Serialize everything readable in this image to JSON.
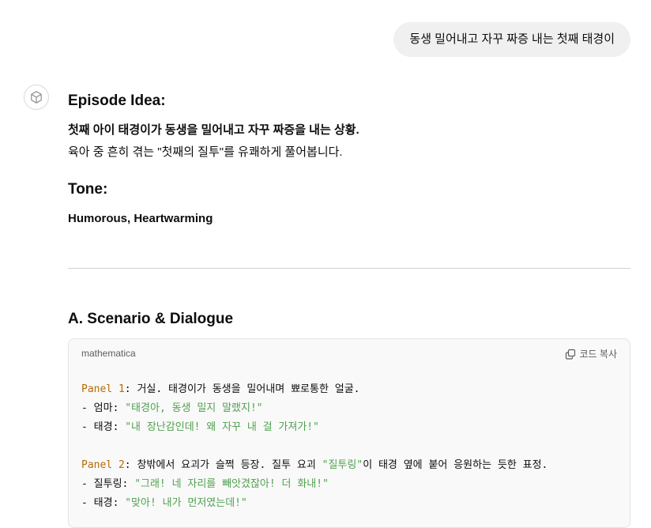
{
  "user_message": "동생 밀어내고 자꾸 짜증 내는 첫째 태경이",
  "assistant": {
    "avatar_icon": "openai-logo-icon",
    "episode_heading": "Episode Idea:",
    "episode_bold": "첫째 아이 태경이가 동생을 밀어내고 자꾸 짜증을 내는 상황.",
    "episode_text": "육아 중 흔히 겪는 \"첫째의 질투\"를 유쾌하게 풀어봅니다.",
    "tone_heading": "Tone:",
    "tone_text": "Humorous, Heartwarming",
    "scenario_heading": "A. Scenario & Dialogue"
  },
  "code_block": {
    "language": "mathematica",
    "copy_label": "코드 복사",
    "copy_icon": "copy-icon",
    "panel1": {
      "label": "Panel 1",
      "desc": ": 거실. 태경이가 동생을 밀어내며 뾰로통한 얼굴.",
      "line1_prefix": "- 엄마: ",
      "line1_quote": "\"태경아, 동생 밀지 말랬지!\"",
      "line2_prefix": "- 태경: ",
      "line2_quote": "\"내 장난감인데! 왜 자꾸 내 걸 가져가!\""
    },
    "panel2": {
      "label": "Panel 2",
      "desc_a": ": 창밖에서 요괴가 슬쩍 등장. 질투 요괴 ",
      "desc_quote": "\"질투링\"",
      "desc_b": "이 태경 옆에 붙어 응원하는 듯한 표정.",
      "line1_prefix": "- 질투링: ",
      "line1_quote": "\"그래! 네 자리를 빼앗겼잖아! 더 화내!\"",
      "line2_prefix": "- 태경: ",
      "line2_quote": "\"맞아! 내가 먼저였는데!\""
    }
  }
}
